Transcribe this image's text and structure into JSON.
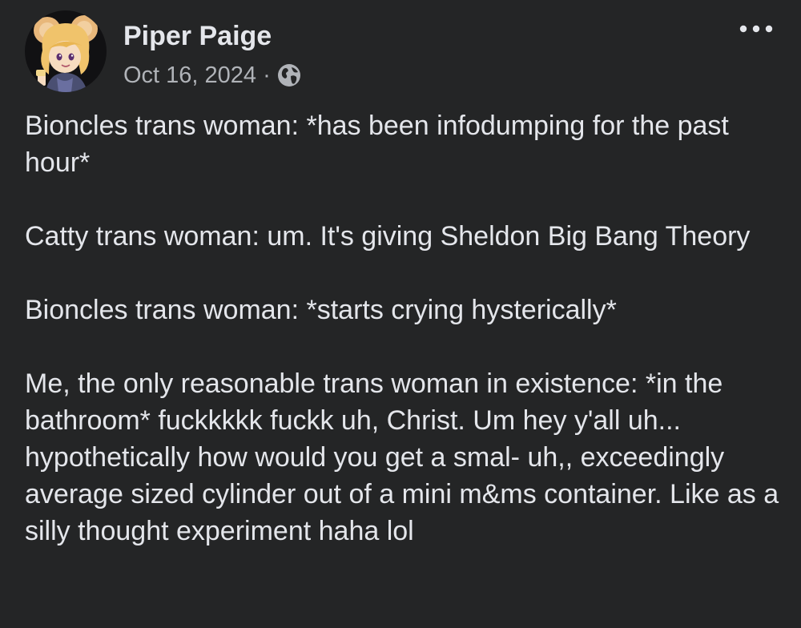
{
  "post": {
    "author": {
      "name": "Piper Paige",
      "avatar_icon": "profile-avatar-cartoon-mouse"
    },
    "meta": {
      "date": "Oct 16, 2024",
      "separator": "·",
      "audience_icon": "globe-icon"
    },
    "more_icon": "ellipsis-icon",
    "paragraphs": [
      "Bioncles trans woman: *has been infodumping for the past hour*",
      "Catty trans woman: um. It's giving Sheldon Big Bang Theory",
      "Bioncles trans woman: *starts crying hysterically*",
      "Me, the only reasonable trans woman in existence: *in the bathroom* fuckkkkk fuckk uh, Christ. Um hey y'all uh... hypothetically how would you get a smal- uh,, exceedingly average sized cylinder out of a mini m&ms container. Like as a silly thought experiment haha lol"
    ]
  },
  "colors": {
    "background": "#242526",
    "primary_text": "#e4e6eb",
    "secondary_text": "#b0b3b8"
  }
}
